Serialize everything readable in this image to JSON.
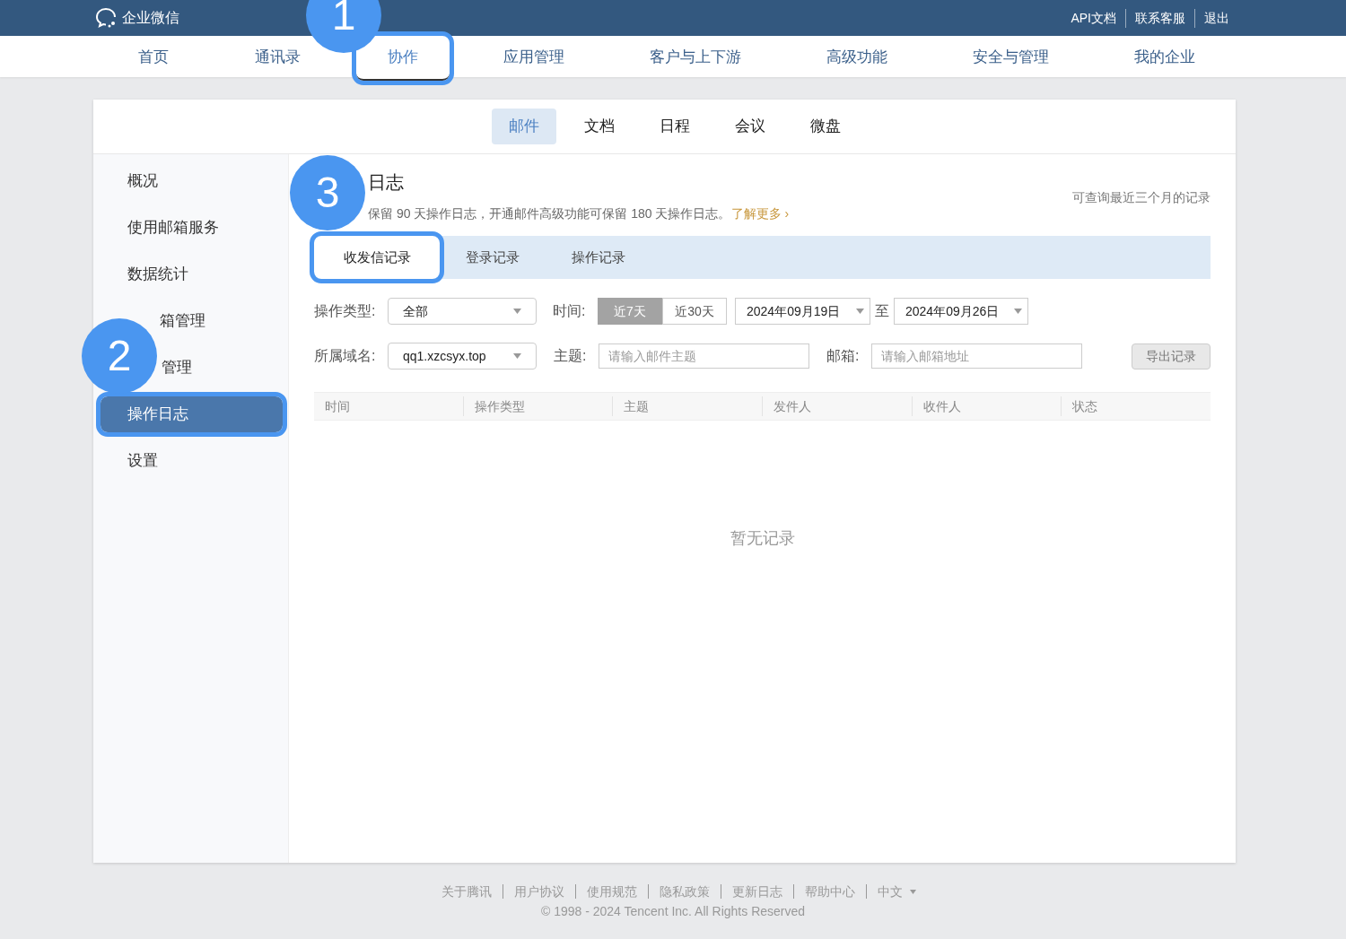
{
  "top_bar": {
    "logo_text": "企业微信",
    "links": [
      "API文档",
      "联系客服",
      "退出"
    ]
  },
  "nav": [
    {
      "label": "首页",
      "selected": false,
      "highlighted": false
    },
    {
      "label": "通讯录",
      "selected": false,
      "highlighted": false
    },
    {
      "label": "协作",
      "selected": true,
      "highlighted": true
    },
    {
      "label": "应用管理",
      "selected": false,
      "highlighted": false
    },
    {
      "label": "客户与上下游",
      "selected": false,
      "highlighted": false
    },
    {
      "label": "高级功能",
      "selected": false,
      "highlighted": false
    },
    {
      "label": "安全与管理",
      "selected": false,
      "highlighted": false
    },
    {
      "label": "我的企业",
      "selected": false,
      "highlighted": false
    }
  ],
  "sub_tabs": [
    {
      "label": "邮件",
      "selected": true
    },
    {
      "label": "文档",
      "selected": false
    },
    {
      "label": "日程",
      "selected": false
    },
    {
      "label": "会议",
      "selected": false
    },
    {
      "label": "微盘",
      "selected": false
    }
  ],
  "sidebar": [
    {
      "label": "概况",
      "selected": false,
      "highlighted": false
    },
    {
      "label": "使用邮箱服务",
      "selected": false,
      "highlighted": false
    },
    {
      "label": "数据统计",
      "selected": false,
      "highlighted": false
    },
    {
      "label": "箱管理",
      "selected": false,
      "highlighted": false
    },
    {
      "label": "管理",
      "selected": false,
      "highlighted": false
    },
    {
      "label": "操作日志",
      "selected": true,
      "highlighted": true
    },
    {
      "label": "设置",
      "selected": false,
      "highlighted": false
    }
  ],
  "page": {
    "title": "日志",
    "description": "保留 90 天操作日志，开通邮件高级功能可保留 180 天操作日志。",
    "learn_more": "了解更多",
    "learn_more_arrow": "›",
    "note": "可查询最近三个月的记录"
  },
  "record_tabs": [
    {
      "label": "收发信记录",
      "selected": true,
      "highlighted": true
    },
    {
      "label": "登录记录",
      "selected": false,
      "highlighted": false
    },
    {
      "label": "操作记录",
      "selected": false,
      "highlighted": false
    }
  ],
  "filters": {
    "operation_type": {
      "label": "操作类型:",
      "value": "全部"
    },
    "time": {
      "label": "时间:",
      "ranges": [
        {
          "label": "近7天",
          "selected": true
        },
        {
          "label": "近30天",
          "selected": false
        }
      ],
      "start": "2024年09月19日",
      "to": "至",
      "end": "2024年09月26日"
    },
    "domain": {
      "label": "所属域名:",
      "value": "qq1.xzcsyx.top"
    },
    "subject": {
      "label": "主题:",
      "placeholder": "请输入邮件主题"
    },
    "mailbox": {
      "label": "邮箱:",
      "placeholder": "请输入邮箱地址"
    },
    "export_button": "导出记录"
  },
  "table": {
    "columns": [
      "时间",
      "操作类型",
      "主题",
      "发件人",
      "收件人",
      "状态"
    ],
    "empty_text": "暂无记录"
  },
  "footer": {
    "links": [
      "关于腾讯",
      "用户协议",
      "使用规范",
      "隐私政策",
      "更新日志",
      "帮助中心"
    ],
    "language": "中文",
    "copyright": "© 1998 - 2024 Tencent Inc. All Rights Reserved"
  },
  "annotations": [
    {
      "number": "1"
    },
    {
      "number": "2"
    },
    {
      "number": "3"
    }
  ]
}
